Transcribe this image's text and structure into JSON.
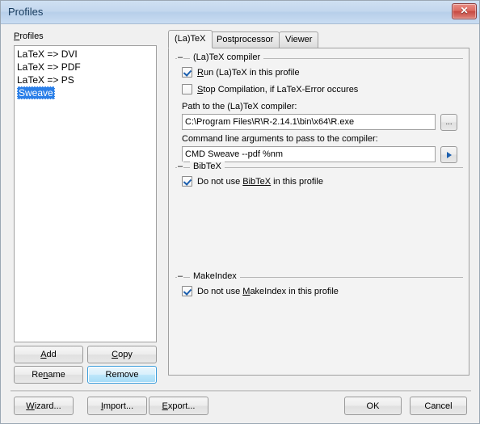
{
  "window": {
    "title": "Profiles",
    "close_label": "✕",
    "close_icon": "close-icon"
  },
  "left": {
    "profiles_label": "Profiles",
    "profiles_label_acc": "P",
    "items": [
      {
        "label": "LaTeX => DVI",
        "selected": false
      },
      {
        "label": "LaTeX => PDF",
        "selected": false
      },
      {
        "label": "LaTeX => PS",
        "selected": false
      },
      {
        "label": "Sweave",
        "selected": true
      }
    ],
    "buttons": {
      "add": {
        "label": "Add",
        "acc": "A"
      },
      "copy": {
        "label": "Copy",
        "acc": "C"
      },
      "rename": {
        "label": "Rename",
        "acc": "n"
      },
      "remove": {
        "label": "Remove",
        "acc": "",
        "state": "hover"
      }
    }
  },
  "tabs": [
    {
      "label": "(La)TeX",
      "active": true
    },
    {
      "label": "Postprocessor",
      "active": false
    },
    {
      "label": "Viewer",
      "active": false
    }
  ],
  "latex_tab": {
    "compiler_group": {
      "title": "(La)TeX compiler",
      "run_checkbox": {
        "label": "Run (La)TeX in this profile",
        "acc": "R",
        "checked": true
      },
      "stop_checkbox": {
        "label": "Stop Compilation, if LaTeX-Error occures",
        "acc": "S",
        "checked": false
      },
      "path_label": "Path to the (La)TeX compiler:",
      "path_value": "C:\\Program Files\\R\\R-2.14.1\\bin\\x64\\R.exe",
      "browse_button_label": "...",
      "args_label": "Command line arguments to pass to the compiler:",
      "args_value": "CMD Sweave --pdf %nm",
      "args_button_icon": "arrow-right-icon"
    },
    "bibtex_group": {
      "title": "BibTeX",
      "checkbox": {
        "label": "Do not use BibTeX in this profile",
        "acc": "BibTeX",
        "checked": true
      }
    },
    "makeindex_group": {
      "title": "MakeIndex",
      "checkbox": {
        "label": "Do not use MakeIndex in this profile",
        "acc": "M",
        "checked": true
      }
    }
  },
  "footer": {
    "wizard": {
      "label": "Wizard...",
      "acc": "W"
    },
    "import": {
      "label": "Import...",
      "acc": "I"
    },
    "export": {
      "label": "Export...",
      "acc": "E"
    },
    "ok": {
      "label": "OK"
    },
    "cancel": {
      "label": "Cancel"
    }
  },
  "colors": {
    "titlebar_start": "#cfe0f2",
    "titlebar_end": "#c9dcf2",
    "selection_blue": "#2a7fe8",
    "hover_blue": "#bce6fa",
    "check_blue": "#1c5fae",
    "close_red": "#c64a42",
    "dialog_bg": "#f0f0f0",
    "panel_bg": "#f3f3f3"
  }
}
